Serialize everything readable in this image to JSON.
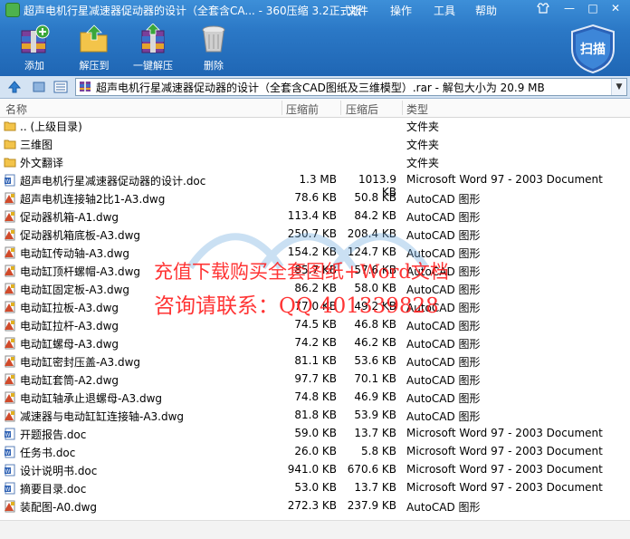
{
  "window": {
    "title": "超声电机行星减速器促动器的设计（全套含CA... - 360压缩 3.2正式版",
    "menus": [
      "文件",
      "操作",
      "工具",
      "帮助"
    ],
    "controls": [
      "—",
      "□",
      "✕"
    ]
  },
  "toolbar": {
    "add": "添加",
    "extract_to": "解压到",
    "one_click": "一键解压",
    "delete": "删除",
    "scan": "扫描"
  },
  "address": {
    "path": "超声电机行星减速器促动器的设计（全套含CAD图纸及三维模型）.rar - 解包大小为 20.9 MB"
  },
  "columns": {
    "name": "名称",
    "packed": "压缩前",
    "size": "压缩后",
    "type": "类型"
  },
  "files": [
    {
      "icon": "up-folder-icon",
      "name": ".. (上级目录)",
      "packed": "",
      "size": "",
      "type": "文件夹"
    },
    {
      "icon": "folder-icon",
      "name": "三维图",
      "packed": "",
      "size": "",
      "type": "文件夹"
    },
    {
      "icon": "folder-icon",
      "name": "外文翻译",
      "packed": "",
      "size": "",
      "type": "文件夹"
    },
    {
      "icon": "doc-icon",
      "name": "超声电机行星减速器促动器的设计.doc",
      "packed": "1.3 MB",
      "size": "1013.9 KB",
      "type": "Microsoft Word 97 - 2003 Document"
    },
    {
      "icon": "dwg-icon",
      "name": "超声电机连接轴2比1-A3.dwg",
      "packed": "78.6 KB",
      "size": "50.8 KB",
      "type": "AutoCAD 图形"
    },
    {
      "icon": "dwg-icon",
      "name": "促动器机箱-A1.dwg",
      "packed": "113.4 KB",
      "size": "84.2 KB",
      "type": "AutoCAD 图形"
    },
    {
      "icon": "dwg-icon",
      "name": "促动器机箱底板-A3.dwg",
      "packed": "250.7 KB",
      "size": "208.4 KB",
      "type": "AutoCAD 图形"
    },
    {
      "icon": "dwg-icon",
      "name": "电动缸传动轴-A3.dwg",
      "packed": "154.2 KB",
      "size": "124.7 KB",
      "type": "AutoCAD 图形"
    },
    {
      "icon": "dwg-icon",
      "name": "电动缸顶杆螺帽-A3.dwg",
      "packed": "85.7 KB",
      "size": "57.6 KB",
      "type": "AutoCAD 图形"
    },
    {
      "icon": "dwg-icon",
      "name": "电动缸固定板-A3.dwg",
      "packed": "86.2 KB",
      "size": "58.0 KB",
      "type": "AutoCAD 图形"
    },
    {
      "icon": "dwg-icon",
      "name": "电动缸拉板-A3.dwg",
      "packed": "77.0 KB",
      "size": "49.2 KB",
      "type": "AutoCAD 图形"
    },
    {
      "icon": "dwg-icon",
      "name": "电动缸拉杆-A3.dwg",
      "packed": "74.5 KB",
      "size": "46.8 KB",
      "type": "AutoCAD 图形"
    },
    {
      "icon": "dwg-icon",
      "name": "电动缸螺母-A3.dwg",
      "packed": "74.2 KB",
      "size": "46.2 KB",
      "type": "AutoCAD 图形"
    },
    {
      "icon": "dwg-icon",
      "name": "电动缸密封压盖-A3.dwg",
      "packed": "81.1 KB",
      "size": "53.6 KB",
      "type": "AutoCAD 图形"
    },
    {
      "icon": "dwg-icon",
      "name": "电动缸套筒-A2.dwg",
      "packed": "97.7 KB",
      "size": "70.1 KB",
      "type": "AutoCAD 图形"
    },
    {
      "icon": "dwg-icon",
      "name": "电动缸轴承止退螺母-A3.dwg",
      "packed": "74.8 KB",
      "size": "46.9 KB",
      "type": "AutoCAD 图形"
    },
    {
      "icon": "dwg-icon",
      "name": "减速器与电动缸缸连接轴-A3.dwg",
      "packed": "81.8 KB",
      "size": "53.9 KB",
      "type": "AutoCAD 图形"
    },
    {
      "icon": "doc-icon",
      "name": "开题报告.doc",
      "packed": "59.0 KB",
      "size": "13.7 KB",
      "type": "Microsoft Word 97 - 2003 Document"
    },
    {
      "icon": "doc-icon",
      "name": "任务书.doc",
      "packed": "26.0 KB",
      "size": "5.8 KB",
      "type": "Microsoft Word 97 - 2003 Document"
    },
    {
      "icon": "doc-icon",
      "name": "设计说明书.doc",
      "packed": "941.0 KB",
      "size": "670.6 KB",
      "type": "Microsoft Word 97 - 2003 Document"
    },
    {
      "icon": "doc-icon",
      "name": "摘要目录.doc",
      "packed": "53.0 KB",
      "size": "13.7 KB",
      "type": "Microsoft Word 97 - 2003 Document"
    },
    {
      "icon": "dwg-icon",
      "name": "装配图-A0.dwg",
      "packed": "272.3 KB",
      "size": "237.9 KB",
      "type": "AutoCAD 图形"
    }
  ],
  "watermark": {
    "line1": "充值下载购买全套图纸+Word文档",
    "line2": "咨询请联系：QQ 401339828"
  }
}
